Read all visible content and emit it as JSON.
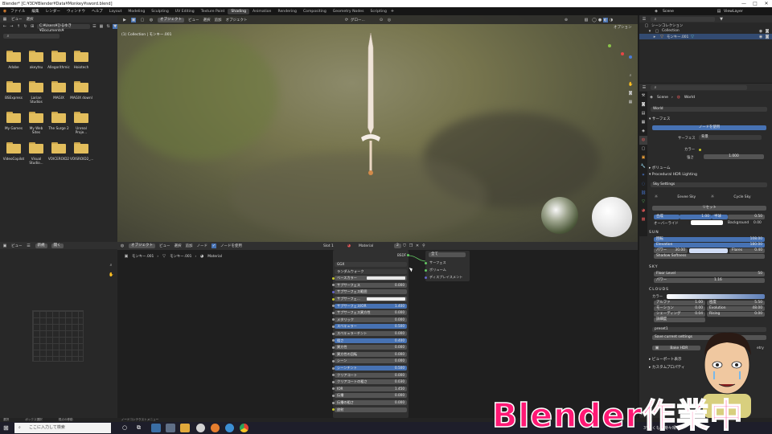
{
  "window": {
    "title": "Blender* [C:¥3D¥Blender¥Data¥Monkey¥sword.blend]",
    "controls": [
      "—",
      "□",
      "✕"
    ]
  },
  "menubar": {
    "items": [
      "ファイル",
      "編集",
      "レンダー",
      "ウィンドウ",
      "ヘルプ"
    ],
    "workspaces": [
      "Layout",
      "Modeling",
      "Sculpting",
      "UV Editing",
      "Texture Paint",
      "Shading",
      "Animation",
      "Rendering",
      "Compositing",
      "Geometry Nodes",
      "Scripting"
    ],
    "active_workspace": "Shading",
    "scene_label": "Scene",
    "viewlayer_label": "ViewLayer"
  },
  "filebrowser": {
    "header": [
      "ビュー",
      "選択"
    ],
    "path": "C:¥Users¥ひるゆき¥Documents¥",
    "folders": [
      [
        "Adobe",
        "akeytsu",
        "Allegorithmic",
        "Hoiotech"
      ],
      [
        "BSExpress",
        "Larian Studios",
        "MAGIX",
        "MAGIX downl"
      ],
      [
        "My Games",
        "My Web Sites",
        "The Surge 2",
        "Unreal Proje..."
      ],
      [
        "VideoCopilot",
        "Visual Studio...",
        "VOICEROID2",
        "VOISROID2_..."
      ]
    ]
  },
  "viewport": {
    "header": [
      "オブジェクト",
      "ビュー",
      "選択",
      "追加",
      "オブジェクト"
    ],
    "transform": "グロー...",
    "options": "オプション",
    "info": "(1) Collection | モンキー.001"
  },
  "outliner": {
    "root": "シーンコレクション",
    "collection": "Collection",
    "object": "モンキー.001"
  },
  "properties": {
    "breadcrumb_scene": "Scene",
    "breadcrumb_world": "World",
    "world_name": "World",
    "surface_panel": "サーフェス",
    "use_nodes": "ノードを使用",
    "surface_label": "サーフェス",
    "surface_value": "背景",
    "color_label": "カラー",
    "strength_label": "強さ",
    "strength_value": "1.000",
    "volume_panel": "ボリューム",
    "hdr_panel": "Procedural HDR Lighting",
    "sky_settings": "Sky Settings",
    "envee_sky": "Eevee Sky",
    "cycle_sky": "Cycle Sky",
    "reset": "リセット",
    "row1_left": "合成",
    "row1_mid": "1.00",
    "row1_mid2": "半球",
    "row1_right": "0.50",
    "override": "オーバーライド",
    "background": "Background",
    "background_val": "0.00",
    "sun_label": "SUN",
    "rotation": "回転",
    "rotation_val": "108.00",
    "elevation": "Elevation",
    "elevation_val": "180.00",
    "power": "パワー",
    "power_val": "30.00",
    "flares": "Flares",
    "flares_val": "0.40",
    "shadow_softness": "Shadow Softness",
    "sky_label": "SKY",
    "floor_level": "Floor Level",
    "floor_val": "50",
    "sky_power": "パワー",
    "sky_power_val": "1.16",
    "clouds_label": "CLOUDS",
    "cloud_color": "カラー",
    "alpha": "アルファ",
    "alpha_val": "1.00",
    "density": "密度",
    "density_val": "5.50",
    "motion": "モーション",
    "motion_val": "0.00",
    "evolution": "Evolution",
    "evolution_val": "48.00",
    "shading": "シェーディング",
    "shading_val": "0.04",
    "rising": "Rising",
    "rising_val": "0.00",
    "detail": "詳細度",
    "preset": "preset1",
    "save_settings": "Save current settings",
    "bake_hdr": "Bake HDR",
    "etry": "etry",
    "viewport_display": "ビューポート表示",
    "custom_props": "カスタムプロパティ"
  },
  "nodeeditor": {
    "header": [
      "オブジェクト",
      "ビュー",
      "選択",
      "追加",
      "ノード"
    ],
    "use_nodes": "ノードを使用",
    "slot": "Slot 1",
    "material": "Material",
    "users": "2",
    "breadcrumb": [
      "モンキー.001",
      "モンキー.001",
      "Material"
    ],
    "bsdf_header": "BSDF",
    "bsdf_rows": [
      {
        "label": "GGX",
        "value": ""
      },
      {
        "label": "ランダムウォーク",
        "value": ""
      },
      {
        "label": "ベースカラー",
        "value": ""
      },
      {
        "label": "サブサーフェス",
        "value": "0.000"
      },
      {
        "label": "サブサーフェス範囲",
        "value": ""
      },
      {
        "label": "サブサーフェ...",
        "value": ""
      },
      {
        "label": "サブサーフェスIOR",
        "value": "1.400"
      },
      {
        "label": "サブサーフェス異方性",
        "value": "0.000"
      },
      {
        "label": "メタリック",
        "value": "0.000"
      },
      {
        "label": "スペキュラー",
        "value": "0.500"
      },
      {
        "label": "スペキュラーチント",
        "value": "0.000"
      },
      {
        "label": "粗さ",
        "value": "0.400"
      },
      {
        "label": "異方性",
        "value": "0.000"
      },
      {
        "label": "異方性の回転",
        "value": "0.000"
      },
      {
        "label": "シーン",
        "value": "0.000"
      },
      {
        "label": "シーンチント",
        "value": "0.500"
      },
      {
        "label": "クリアコート",
        "value": "0.000"
      },
      {
        "label": "クリアコートの粗さ",
        "value": "0.030"
      },
      {
        "label": "IOR",
        "value": "1.450"
      },
      {
        "label": "伝播",
        "value": "0.000"
      },
      {
        "label": "伝播の粗さ",
        "value": "0.000"
      },
      {
        "label": "放射",
        "value": ""
      }
    ],
    "output_node": {
      "target": "全て",
      "sockets": [
        "サーフェス",
        "ボリューム",
        "ディスプレイスメント"
      ]
    }
  },
  "leftview": {
    "header": [
      "ビュー",
      "新規",
      "開く"
    ]
  },
  "statusbar": [
    "選択",
    "ボックス選択",
    "視点の移動",
    "ノードコンテクストメニュー"
  ],
  "taskbar": {
    "search_placeholder": "ここに入力して検索",
    "weather": "3°C くもり時々晴れ"
  },
  "overlay": {
    "text": "Blender作業中"
  },
  "colors": {
    "accent": "#4772b3",
    "folder": "#e2bd5c",
    "overlay_text": "#ff1874",
    "socket_yellow": "#c7c729",
    "socket_gray": "#a1a1a1",
    "socket_purple": "#6363c7",
    "socket_green": "#63c763"
  }
}
